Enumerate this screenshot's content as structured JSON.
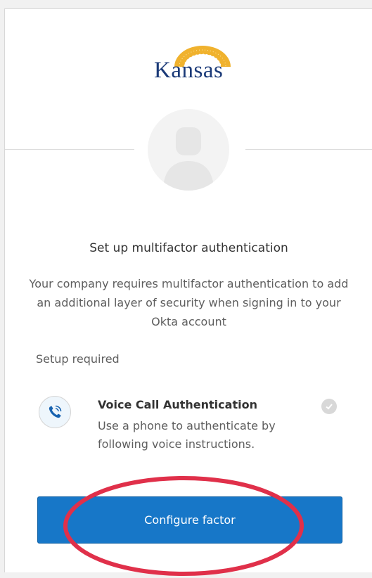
{
  "logo": {
    "text": "Kansas"
  },
  "title": "Set up multifactor authentication",
  "subtitle": "Your company requires multifactor authentication to add an additional layer of security when signing in to your Okta account",
  "setup_label": "Setup required",
  "factor": {
    "icon": "phone-call-icon",
    "name": "Voice Call Authentication",
    "description": "Use a phone to authenticate by following voice instructions.",
    "status_icon": "checkmark-icon"
  },
  "button": {
    "label": "Configure factor"
  },
  "colors": {
    "button": "#1777c8",
    "highlight": "#e0304a",
    "logo": "#1b3a78",
    "sun": "#f0b22e"
  }
}
